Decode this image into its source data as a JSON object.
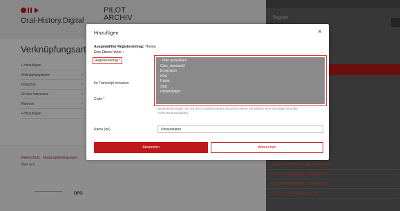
{
  "site": {
    "name": "Oral-History.Digital",
    "pilot_line1": "PILOT",
    "pilot_line2": "ARCHIV",
    "right_register_label": "Register"
  },
  "left": {
    "title": "Verknüpfungsart",
    "menu": [
      {
        "label": "+ Hinzufügen"
      },
      {
        "label": "Verknüpfungstypen",
        "chev": "›"
      },
      {
        "label": "Zeitachse",
        "chev": "›"
      },
      {
        "label": "Ort des Interviews",
        "chev": "›"
      },
      {
        "label": "Wohnort",
        "chev": "›"
      },
      {
        "label": "+ Hinzufügen"
      }
    ]
  },
  "footer": {
    "line1": "Datenschutz · Nutzungsbedingungen",
    "line2": "Über uns",
    "logo2": "DFG"
  },
  "right_links": [
    {
      "label": "VERKNÜPFUNGSARTEN BEARBEITEN",
      "arrow": "›"
    },
    {
      "label": "REGISTEREINTRÄGE BEARBEITEN",
      "arrow": "›"
    },
    {
      "label": "REGISTEREINTRÄGE VERWALTEN",
      "arrow": "›"
    },
    {
      "label": "SAMMLUNGEN BEARBEITEN",
      "arrow": "›"
    }
  ],
  "dialog": {
    "title": "Hinzufügen",
    "close": "×",
    "selected_label": "Ausgewählter Registereintrag:",
    "selected_value": "Thema",
    "up_link": "Eine Ebene höher ↑",
    "field_registereintrag": "Registereintrag *",
    "field_transcript": "Im Transkript benutzen",
    "field_code": "Code *",
    "field_name": "Name (de)",
    "listbox_options": [
      "- Bitte auswählen",
      "Civic_standard2",
      "Emigration",
      "HVA",
      "Politik",
      "SED",
      "Universitäten"
    ],
    "help_text": "Bindestrichvorlage und nur mit Grossbuchstaben benutzen (wenn Sie wirklich eine einmalige Id wollen, Administratoraufgabe)",
    "name_value": "Universitäten",
    "submit_label": "Absenden",
    "cancel_label": "Abbrechen"
  },
  "colors": {
    "accent": "#c0181a",
    "highlight": "#e23a2a",
    "listbox_bg": "#8a8a8a"
  }
}
